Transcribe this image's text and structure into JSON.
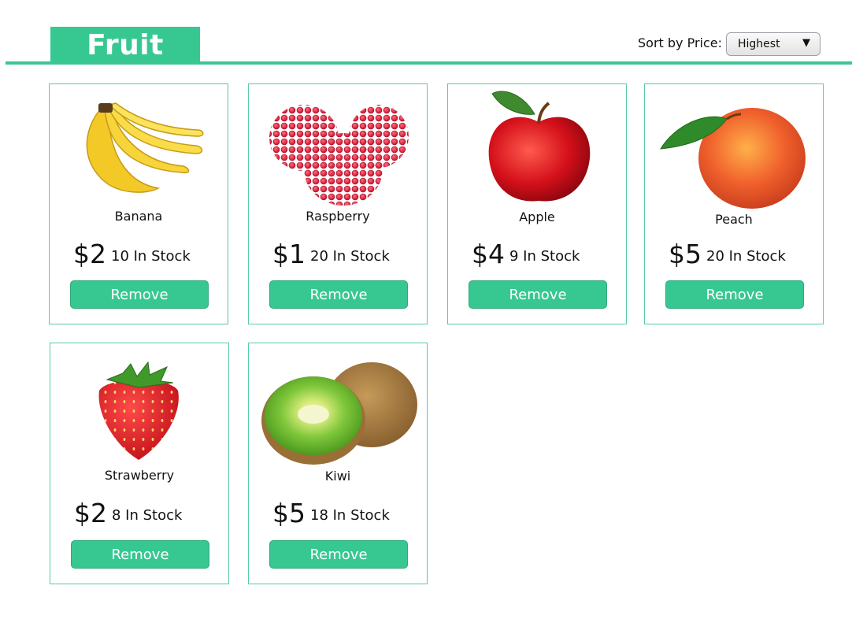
{
  "header": {
    "logo_text": "Fruit",
    "sort_label": "Sort by Price:",
    "sort_selected": "Highest",
    "sort_arrow": "▼"
  },
  "products": [
    {
      "name": "Banana",
      "price": "$2",
      "stock": "10 In Stock",
      "remove_label": "Remove",
      "image_icon": "banana-image"
    },
    {
      "name": "Raspberry",
      "price": "$1",
      "stock": "20 In Stock",
      "remove_label": "Remove",
      "image_icon": "raspberry-image"
    },
    {
      "name": "Apple",
      "price": "$4",
      "stock": "9 In Stock",
      "remove_label": "Remove",
      "image_icon": "apple-image"
    },
    {
      "name": "Peach",
      "price": "$5",
      "stock": "20 In Stock",
      "remove_label": "Remove",
      "image_icon": "peach-image"
    },
    {
      "name": "Strawberry",
      "price": "$2",
      "stock": "8 In Stock",
      "remove_label": "Remove",
      "image_icon": "strawberry-image"
    },
    {
      "name": "Kiwi",
      "price": "$5",
      "stock": "18 In Stock",
      "remove_label": "Remove",
      "image_icon": "kiwi-image"
    }
  ],
  "colors": {
    "accent": "#37c892",
    "card_border": "#58cc9f"
  }
}
